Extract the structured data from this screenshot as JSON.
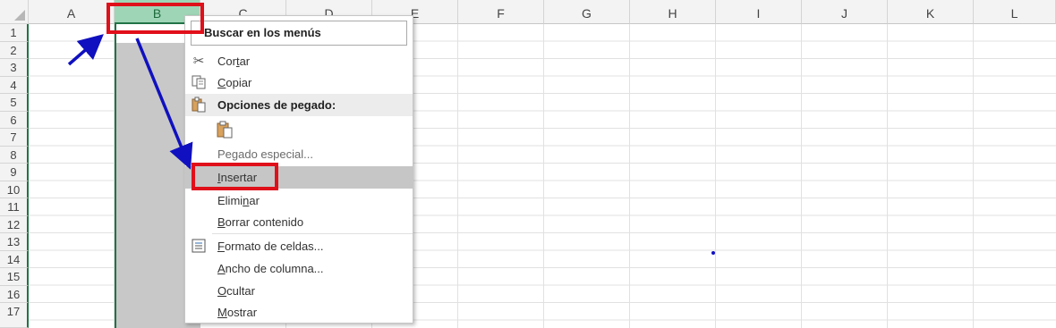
{
  "columns": [
    "A",
    "B",
    "C",
    "D",
    "E",
    "F",
    "G",
    "H",
    "I",
    "J",
    "K",
    "L"
  ],
  "rows": [
    "1",
    "2",
    "3",
    "4",
    "5",
    "6",
    "7",
    "8",
    "9",
    "10",
    "11",
    "12",
    "13",
    "14",
    "15",
    "16",
    "17"
  ],
  "menu": {
    "search_placeholder": "Buscar en los menús",
    "items": [
      {
        "pre": "Cor",
        "u": "t",
        "post": "ar",
        "icon": "scissors-icon"
      },
      {
        "pre": "",
        "u": "C",
        "post": "opiar",
        "icon": "copy-icon"
      },
      {
        "label": "Opciones de pegado:",
        "icon": "paste-icon"
      },
      {
        "label": "",
        "icon": "paste-icon"
      },
      {
        "pre": "Pegado especial...",
        "u": "",
        "post": ""
      },
      {
        "pre": "",
        "u": "I",
        "post": "nsertar"
      },
      {
        "pre": "Elimi",
        "u": "n",
        "post": "ar"
      },
      {
        "pre": "",
        "u": "B",
        "post": "orrar contenido"
      },
      {
        "pre": "",
        "u": "F",
        "post": "ormato de celdas...",
        "icon": "format-cells-icon"
      },
      {
        "pre": "",
        "u": "A",
        "post": "ncho de columna..."
      },
      {
        "pre": "",
        "u": "O",
        "post": "cultar"
      },
      {
        "pre": "",
        "u": "M",
        "post": "ostrar"
      }
    ]
  },
  "colors": {
    "annotation_red": "#e0101a",
    "annotation_blue": "#1010c0",
    "excel_green": "#217346"
  }
}
